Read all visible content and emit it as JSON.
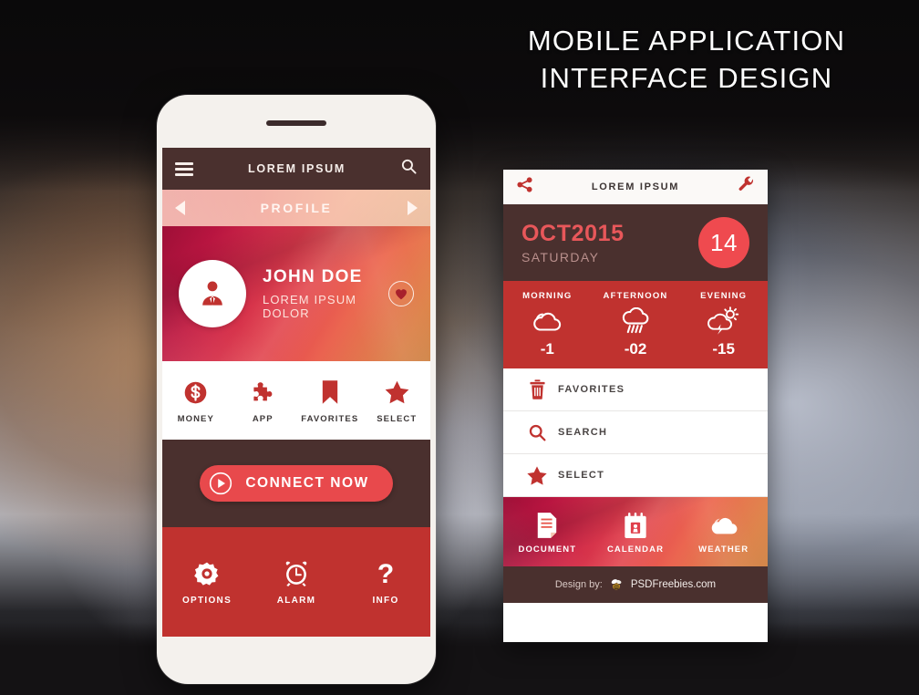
{
  "heading": {
    "line1": "MOBILE APPLICATION",
    "line2": "INTERFACE DESIGN"
  },
  "colors": {
    "dark_brown": "#4a302e",
    "red": "#c0322f",
    "bright_red": "#e8494c",
    "coral": "#ef4a4f",
    "crimson": "#9e0f37",
    "orange": "#f9a159",
    "cream_frame": "#f4f1ed"
  },
  "phone_one": {
    "header": {
      "menu_icon": "hamburger-icon",
      "title": "LOREM IPSUM",
      "search_icon": "search-icon"
    },
    "profile_nav": {
      "prev_icon": "triangle-left-icon",
      "label": "PROFILE",
      "next_icon": "triangle-right-icon"
    },
    "hero": {
      "avatar_icon": "user-business-icon",
      "name": "JOHN DOE",
      "subtitle": "LOREM IPSUM DOLOR",
      "favorite_icon": "heart-icon"
    },
    "quick_actions": [
      {
        "icon": "dollar-coin-icon",
        "label": "MONEY"
      },
      {
        "icon": "puzzle-piece-icon",
        "label": "APP"
      },
      {
        "icon": "bookmark-icon",
        "label": "FAVORITES"
      },
      {
        "icon": "star-icon",
        "label": "SELECT"
      }
    ],
    "connect": {
      "icon": "play-circle-icon",
      "label": "CONNECT NOW"
    },
    "bottom_actions": [
      {
        "icon": "gear-icon",
        "label": "OPTIONS"
      },
      {
        "icon": "alarm-clock-icon",
        "label": "ALARM"
      },
      {
        "icon": "question-mark-icon",
        "label": "INFO"
      }
    ]
  },
  "phone_two": {
    "header": {
      "share_icon": "share-icon",
      "title": "LOREM IPSUM",
      "settings_icon": "wrench-icon"
    },
    "date": {
      "month_year": "OCT2015",
      "weekday": "SATURDAY",
      "day": "14"
    },
    "weather": [
      {
        "period": "MORNING",
        "icon": "cloud-icon",
        "temp": "-1"
      },
      {
        "period": "AFTERNOON",
        "icon": "rain-cloud-icon",
        "temp": "-02"
      },
      {
        "period": "EVENING",
        "icon": "storm-sun-icon",
        "temp": "-15"
      }
    ],
    "menu_rows": [
      {
        "icon": "trash-icon",
        "label": "FAVORITES"
      },
      {
        "icon": "search-icon",
        "label": "SEARCH"
      },
      {
        "icon": "star-icon",
        "label": "SELECT"
      }
    ],
    "app_shortcuts": [
      {
        "icon": "document-icon",
        "label": "DOCUMENT"
      },
      {
        "icon": "calendar-icon",
        "label": "CALENDAR"
      },
      {
        "icon": "cloud-icon",
        "label": "WEATHER"
      }
    ],
    "footer": {
      "prefix": "Design by:",
      "logo_icon": "bee-icon",
      "brand": "PSDFreebies.com"
    }
  }
}
